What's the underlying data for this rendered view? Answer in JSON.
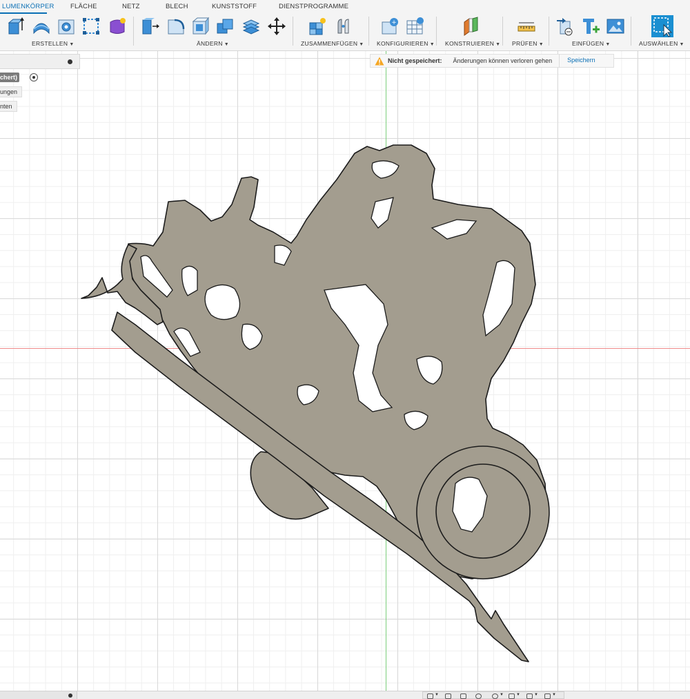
{
  "tabs": [
    {
      "label": "LUMENKÖRPER",
      "active": true
    },
    {
      "label": "FLÄCHE"
    },
    {
      "label": "NETZ"
    },
    {
      "label": "BLECH"
    },
    {
      "label": "KUNSTSTOFF"
    },
    {
      "label": "DIENSTPROGRAMME"
    }
  ],
  "groups": {
    "erstellen": "ERSTELLEN",
    "aendern": "ÄNDERN",
    "zusammenfuegen": "ZUSAMMENFÜGEN",
    "konfigurieren": "KONFIGURIEREN",
    "konstruieren": "KONSTRUIEREN",
    "pruefen": "PRÜFEN",
    "einfuegen": "EINFÜGEN",
    "auswaehlen": "AUSWÄHLEN"
  },
  "warning": {
    "title": "Nicht gespeichert:",
    "message": "Änderungen können verloren gehen",
    "save_label": "Speichern"
  },
  "browser": {
    "node_label": "chert)",
    "items": [
      "ungen",
      "nten"
    ]
  },
  "colors": {
    "accent": "#0a6fb5",
    "part_fill": "#a39d8f",
    "part_edge": "#1c1c1c",
    "axis_x": "#f08a8a",
    "axis_y": "#7ccf7c"
  }
}
